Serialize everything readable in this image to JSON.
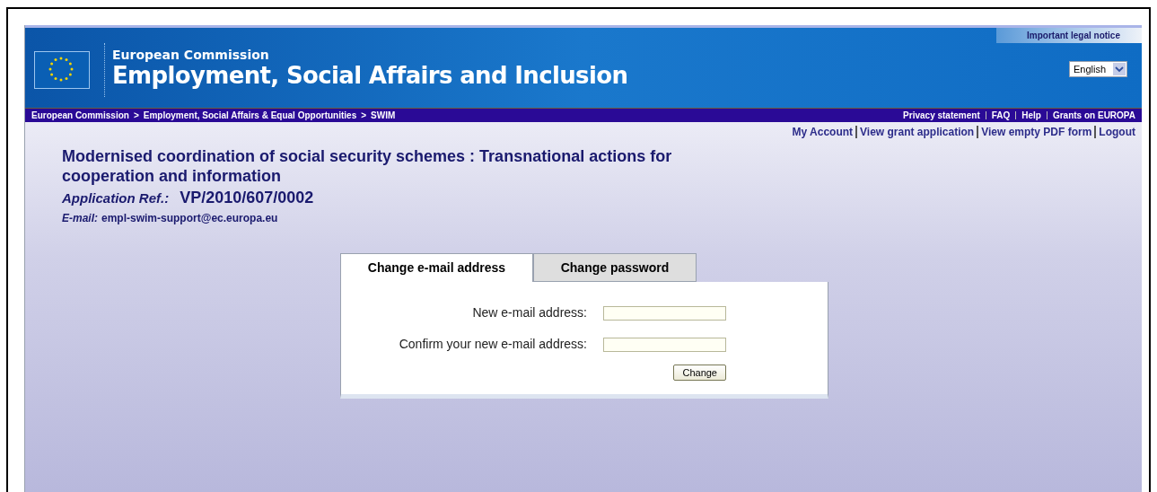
{
  "header": {
    "agency": "European Commission",
    "title": "Employment, Social Affairs and Inclusion",
    "legal_notice": "Important legal notice",
    "language": "English"
  },
  "breadcrumb": [
    "European Commission",
    "Employment, Social Affairs & Equal Opportunities",
    "SWIM"
  ],
  "breadcrumb_separator": ">",
  "top_links": [
    "Privacy statement",
    "FAQ",
    "Help",
    "Grants on EUROPA"
  ],
  "account_links": [
    "My Account",
    "View grant application",
    "View empty PDF form",
    "Logout"
  ],
  "page": {
    "title": "Modernised coordination of social security schemes : Transnational actions for cooperation and information",
    "ref_label": "Application Ref.:",
    "ref": "VP/2010/607/0002",
    "email_label": "E-mail:",
    "email": "empl-swim-support@ec.europa.eu"
  },
  "tabs": [
    {
      "label": "Change e-mail address",
      "selected": true
    },
    {
      "label": "Change password",
      "selected": false
    }
  ],
  "form": {
    "fields": [
      {
        "label": "New e-mail address:"
      },
      {
        "label": "Confirm your new e-mail address:"
      }
    ],
    "button": "Change"
  }
}
